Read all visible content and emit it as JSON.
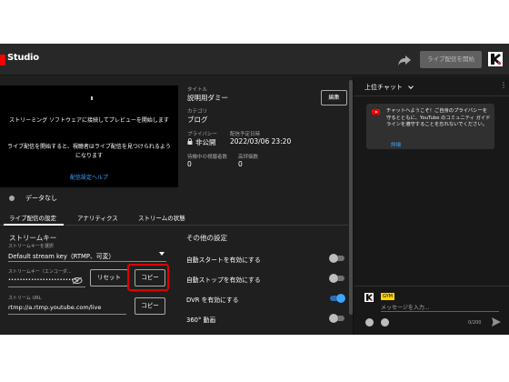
{
  "app": {
    "logo_text": "Studio"
  },
  "topbar": {
    "go_live_label": "ライブ配信を開始"
  },
  "preview": {
    "message1": "ストリーミング ソフトウェアに接続してプレビューを開始します",
    "message2": "ライブ配信を開始すると、視聴者はライブ配信を見つけられるようになります",
    "help_link": "配信設定ヘルプ"
  },
  "details": {
    "title_label": "タイトル",
    "title_value": "説明用ダミー",
    "category_label": "カテゴリ",
    "category_value": "ブログ",
    "privacy_label": "プライバシー",
    "privacy_value": "非公開",
    "scheduled_label": "配信予定日時",
    "scheduled_value": "2022/03/06 23:20",
    "waiting_label": "待機中の視聴者数",
    "waiting_value": "0",
    "likes_label": "高評価数",
    "likes_value": "0",
    "edit_label": "編集"
  },
  "status": {
    "text": "データなし"
  },
  "tabs": [
    {
      "label": "ライブ配信の設定"
    },
    {
      "label": "アナリティクス"
    },
    {
      "label": "ストリームの状態"
    }
  ],
  "stream_key_section": {
    "heading": "ストリームキー",
    "select_label": "ストリームキーを選択",
    "select_value": "Default stream key（RTMP、可変）",
    "key_label": "ストリームキー（エンコーダ...",
    "key_value": "••••••••••••••••••••••••",
    "reset_label": "リセット",
    "copy_label": "コピー",
    "url_label": "ストリーム URL",
    "url_value": "rtmp://a.rtmp.youtube.com/live",
    "url_copy_label": "コピー"
  },
  "other_settings": {
    "heading": "その他の設定",
    "items": [
      {
        "label": "自動スタートを有効にする",
        "on": false
      },
      {
        "label": "自動ストップを有効にする",
        "on": false
      },
      {
        "label": "DVR を有効にする",
        "on": true
      },
      {
        "label": "360° 動画",
        "on": false
      }
    ]
  },
  "chat": {
    "title": "上位チャット",
    "welcome_text": "チャットへようこそ！ご自身のプライバシーを守るとともに、YouTube のコミュニティ ガイドラインを遵守することを忘れないでください。",
    "welcome_link": "詳細",
    "username": "GYM",
    "input_placeholder": "メッセージを入力...",
    "char_count": "0/200"
  },
  "colors": {
    "highlight": "#e00000",
    "accent": "#3ea6ff",
    "brand_red": "#ff0000"
  }
}
